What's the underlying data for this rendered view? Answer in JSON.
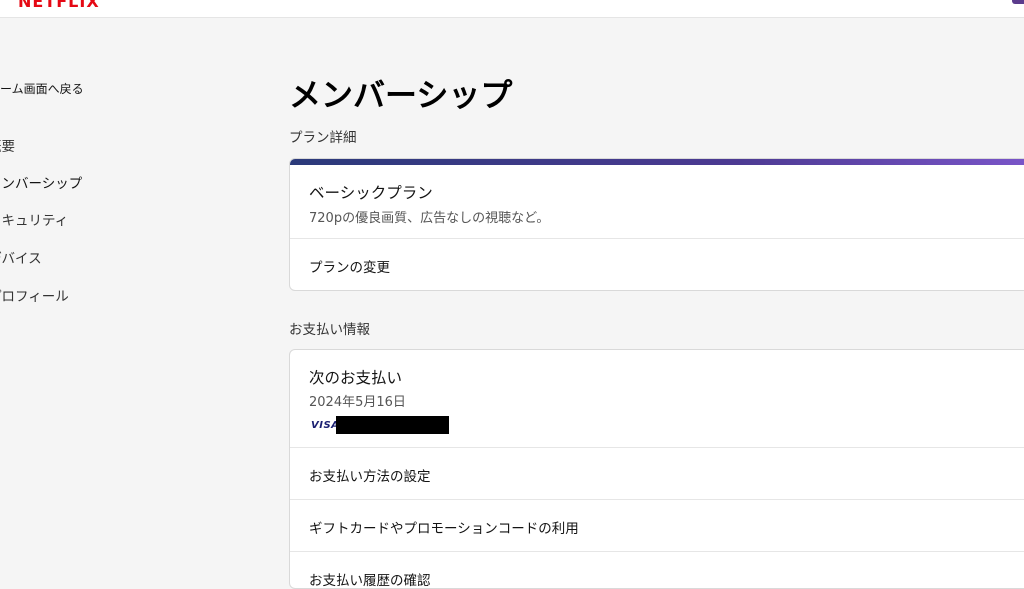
{
  "header": {
    "logo_text": "NETFLIX",
    "brand_color": "#e50914"
  },
  "sidebar": {
    "back_label": "ホーム画面へ戻る",
    "items": [
      {
        "label": "概要"
      },
      {
        "label": "メンバーシップ"
      },
      {
        "label": "セキュリティ"
      },
      {
        "label": "デバイス"
      },
      {
        "label": "プロフィール"
      }
    ]
  },
  "main": {
    "title": "メンバーシップ",
    "plan_section": {
      "label": "プラン詳細",
      "plan_name": "ベーシックプラン",
      "plan_desc": "720pの優良画質、広告なしの視聴など。",
      "change_link": "プランの変更"
    },
    "payment_section": {
      "label": "お支払い情報",
      "next_title": "次のお支払い",
      "next_date": "2024年5月16日",
      "card_brand": "VISA",
      "links": [
        "お支払い方法の設定",
        "ギフトカードやプロモーションコードの利用",
        "お支払い履歴の確認"
      ]
    }
  }
}
